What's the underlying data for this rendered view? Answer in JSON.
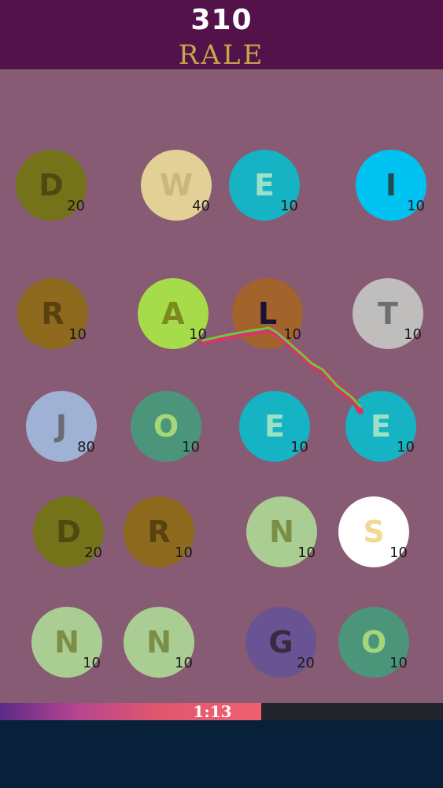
{
  "header": {
    "score": "310",
    "current_word": "RALE"
  },
  "timer": {
    "time_left": "1:13",
    "remaining_fraction": 0.59
  },
  "tiles": [
    {
      "letter": "D",
      "points": "20",
      "bg": "#75731a",
      "fg": "#4d4b0f"
    },
    {
      "letter": "W",
      "points": "40",
      "bg": "#e1d197",
      "fg": "#c9b87c"
    },
    {
      "letter": "E",
      "points": "10",
      "bg": "#15b3c3",
      "fg": "#9be0c7"
    },
    {
      "letter": "I",
      "points": "10",
      "bg": "#00c3f2",
      "fg": "#1f4d52"
    },
    {
      "letter": "R",
      "points": "10",
      "bg": "#8d6a1d",
      "fg": "#5a4210"
    },
    {
      "letter": "A",
      "points": "10",
      "bg": "#a6dc4a",
      "fg": "#7b8a1f"
    },
    {
      "letter": "L",
      "points": "10",
      "bg": "#a3632d",
      "fg": "#1a1336"
    },
    {
      "letter": "T",
      "points": "10",
      "bg": "#c0bdbd",
      "fg": "#6e6e6e"
    },
    {
      "letter": "J",
      "points": "80",
      "bg": "#9fb2d6",
      "fg": "#6b6c75"
    },
    {
      "letter": "O",
      "points": "10",
      "bg": "#4b967b",
      "fg": "#a7d67a"
    },
    {
      "letter": "E",
      "points": "10",
      "bg": "#15b3c3",
      "fg": "#9be0c7"
    },
    {
      "letter": "E",
      "points": "10",
      "bg": "#15b3c3",
      "fg": "#9be0c7"
    },
    {
      "letter": "D",
      "points": "20",
      "bg": "#75731a",
      "fg": "#4d4b0f"
    },
    {
      "letter": "R",
      "points": "10",
      "bg": "#8d6a1d",
      "fg": "#5a4210"
    },
    {
      "letter": "N",
      "points": "10",
      "bg": "#aacd94",
      "fg": "#7c8e45"
    },
    {
      "letter": "S",
      "points": "10",
      "bg": "#ffffff",
      "fg": "#f2d994"
    },
    {
      "letter": "N",
      "points": "10",
      "bg": "#aacd94",
      "fg": "#7c8e45"
    },
    {
      "letter": "N",
      "points": "10",
      "bg": "#aacd94",
      "fg": "#7c8e45"
    },
    {
      "letter": "G",
      "points": "20",
      "bg": "#6a5393",
      "fg": "#3a2a3e"
    },
    {
      "letter": "O",
      "points": "10",
      "bg": "#4b967b",
      "fg": "#a7d67a"
    }
  ]
}
